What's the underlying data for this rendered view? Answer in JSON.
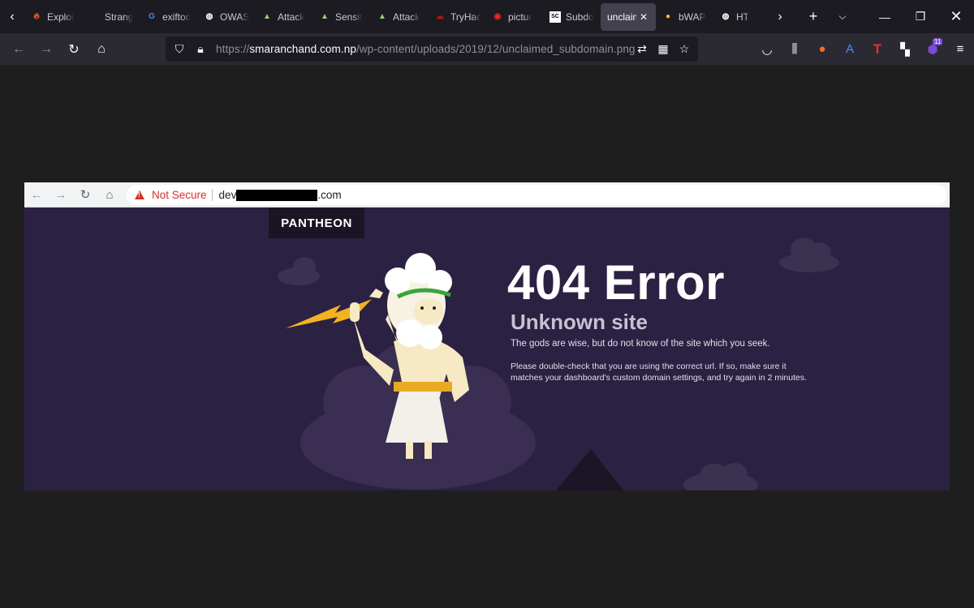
{
  "browser": {
    "tabs": [
      {
        "title": "Exploi",
        "icon": "flame-icon",
        "color": "#e66a2c"
      },
      {
        "title": "Strang",
        "icon": "blank-icon",
        "color": "#1c1b22"
      },
      {
        "title": "exiftoo",
        "icon": "google-icon",
        "color": "#4285f4"
      },
      {
        "title": "OWAS",
        "icon": "owasp-icon",
        "color": "#ffffff"
      },
      {
        "title": "Attack",
        "icon": "attack-icon",
        "color": "#9ad36a"
      },
      {
        "title": "Sensit",
        "icon": "attack-icon",
        "color": "#9ad36a"
      },
      {
        "title": "Attack",
        "icon": "attack-icon",
        "color": "#9ad36a"
      },
      {
        "title": "TryHac",
        "icon": "tryhackme-icon",
        "color": "#c11111"
      },
      {
        "title": "pictur",
        "icon": "picture-icon",
        "color": "#e22c2c"
      },
      {
        "title": "Subdo",
        "icon": "sc-icon",
        "color": "#ffffff"
      },
      {
        "title": "unclaim",
        "icon": "image-icon",
        "active": true
      },
      {
        "title": "bWAP",
        "icon": "bee-icon",
        "color": "#f5c518"
      },
      {
        "title": "HT",
        "icon": "owasp-icon",
        "color": "#ffffff"
      }
    ],
    "url_scheme": "https://",
    "url_host": "smaranchand.com.np",
    "url_path": "/wp-content/uploads/2019/12/unclaimed_subdomain.png",
    "extension_badge": "11"
  },
  "screenshot": {
    "not_secure": "Not Secure",
    "url_prefix": "dev",
    "url_suffix": ".com",
    "brand": "PANTHEON",
    "heading": "404 Error",
    "subheading": "Unknown site",
    "message": "The gods are wise, but do not know of the site which you seek.",
    "help": "Please double-check that you are using the correct url. If so, make sure it matches your dashboard's custom domain settings, and try again in 2 minutes."
  }
}
